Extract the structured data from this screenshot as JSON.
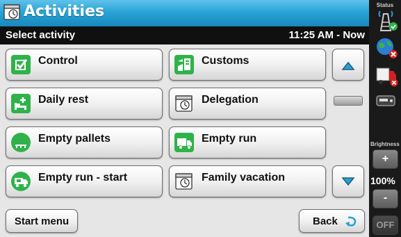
{
  "header": {
    "title": "Activities",
    "subtitle": "Select activity",
    "time": "11:25 AM - Now"
  },
  "activities": [
    {
      "label": "Control",
      "icon": "checkbox-icon"
    },
    {
      "label": "Customs",
      "icon": "customs-icon"
    },
    {
      "label": "Daily rest",
      "icon": "bed-icon"
    },
    {
      "label": "Delegation",
      "icon": "calendar-icon"
    },
    {
      "label": "Empty pallets",
      "icon": "pallet-icon"
    },
    {
      "label": "Empty run",
      "icon": "truck-icon"
    },
    {
      "label": "Empty run - start",
      "icon": "truck-start-icon"
    },
    {
      "label": "Family vacation",
      "icon": "calendar-icon"
    }
  ],
  "footer": {
    "start_menu": "Start menu",
    "back": "Back"
  },
  "side": {
    "status_label": "Status",
    "brightness_label": "Brightness",
    "plus": "+",
    "brightness_value": "100%",
    "minus": "-",
    "off": "OFF"
  },
  "colors": {
    "accent": "#29a3d6",
    "icon_green": "#2fb24a",
    "subbar": "#101010",
    "scroll_arrow": "#2a9fd0"
  }
}
